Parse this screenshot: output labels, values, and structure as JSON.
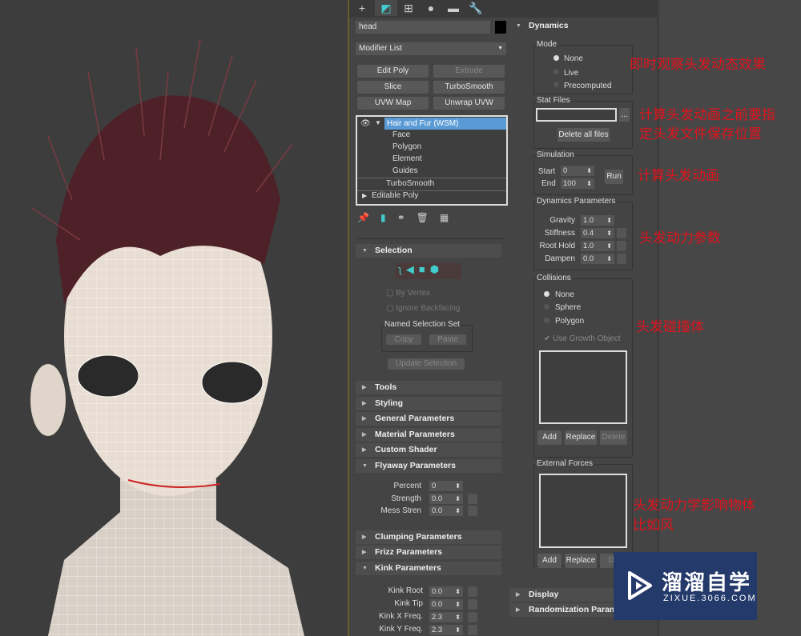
{
  "toolbar": {
    "icons": [
      "create-icon",
      "modify-icon",
      "hierarchy-icon",
      "motion-icon",
      "display-icon",
      "utilities-icon"
    ]
  },
  "object": {
    "name": "head",
    "color": "#000000"
  },
  "modifier_list": {
    "label": "Modifier List"
  },
  "quick_buttons": [
    {
      "label": "Edit Poly",
      "enabled": true
    },
    {
      "label": "Extrude",
      "enabled": false
    },
    {
      "label": "Slice",
      "enabled": true
    },
    {
      "label": "TurboSmooth",
      "enabled": true
    },
    {
      "label": "UVW Map",
      "enabled": true
    },
    {
      "label": "Unwrap UVW",
      "enabled": true
    }
  ],
  "stack": {
    "top": "Hair and Fur (WSM)",
    "subs": [
      "Face",
      "Polygon",
      "Element",
      "Guides"
    ],
    "second": "TurboSmooth",
    "third": "Editable Poly"
  },
  "selection": {
    "title": "Selection",
    "by_vertex": "By Vertex",
    "ignore_backfacing": "Ignore Backfacing",
    "named_set": "Named Selection Set",
    "copy": "Copy",
    "paste": "Paste",
    "update": "Update Selection"
  },
  "rollouts_collapsed": [
    "Tools",
    "Styling",
    "General Parameters",
    "Material Parameters",
    "Custom Shader"
  ],
  "flyaway": {
    "title": "Flyaway Parameters",
    "params": [
      {
        "label": "Percent",
        "value": "0"
      },
      {
        "label": "Strength",
        "value": "0.0"
      },
      {
        "label": "Mess Stren",
        "value": "0.0"
      }
    ]
  },
  "rollouts_collapsed2": [
    "Clumping Parameters",
    "Frizz Parameters"
  ],
  "kink": {
    "title": "Kink Parameters",
    "params": [
      {
        "label": "Kink Root",
        "value": "0.0"
      },
      {
        "label": "Kink Tip",
        "value": "0.0"
      },
      {
        "label": "Kink X Freq.",
        "value": "2.3"
      },
      {
        "label": "Kink Y Freq.",
        "value": "2.3"
      }
    ]
  },
  "dynamics": {
    "title": "Dynamics",
    "mode": {
      "label": "Mode",
      "options": [
        "None",
        "Live",
        "Precomputed"
      ],
      "selected": "None"
    },
    "stat_files": {
      "label": "Stat Files",
      "path": "",
      "browse": "...",
      "delete_all": "Delete all files"
    },
    "simulation": {
      "label": "Simulation",
      "start_label": "Start",
      "start": "0",
      "end_label": "End",
      "end": "100",
      "run": "Run"
    },
    "params": {
      "label": "Dynamics Parameters",
      "items": [
        {
          "label": "Gravity",
          "value": "1.0"
        },
        {
          "label": "Stiffness",
          "value": "0.4"
        },
        {
          "label": "Root Hold",
          "value": "1.0"
        },
        {
          "label": "Dampen",
          "value": "0.0"
        }
      ]
    },
    "collisions": {
      "label": "Collisions",
      "options": [
        "None",
        "Sphere",
        "Polygon"
      ],
      "selected": "None",
      "use_growth": "Use Growth Object",
      "add": "Add",
      "replace": "Replace",
      "delete": "Delete"
    },
    "external": {
      "label": "External Forces",
      "add": "Add",
      "replace": "Replace",
      "delete": "De"
    }
  },
  "bottom_rollouts": [
    "Display",
    "Randomization Parame"
  ],
  "annotations": [
    "即时观察头发动态效果",
    "计算头发动画之前要指",
    "定头发文件保存位置",
    "计算头发动画",
    "头发动力参数",
    "头发碰撞体",
    "头发动力学影响物体",
    "比如风"
  ],
  "watermark": {
    "brand": "溜溜自学",
    "url": "ZIXUE.3066.COM"
  },
  "colors": {
    "accent": "#5b9bd5",
    "annotation": "#e0141e",
    "hair": "#5a2a30"
  }
}
